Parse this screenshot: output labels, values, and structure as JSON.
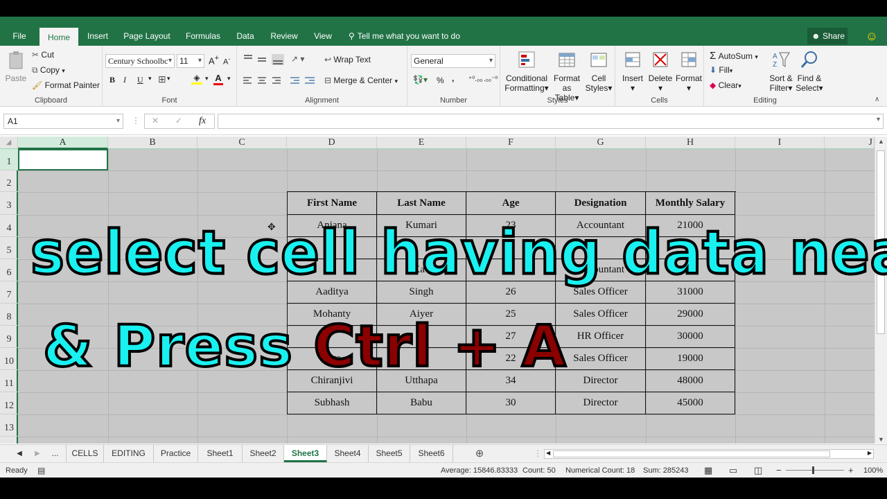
{
  "ribbon_tabs": [
    "File",
    "Home",
    "Insert",
    "Page Layout",
    "Formulas",
    "Data",
    "Review",
    "View",
    "Tell me what you want to do"
  ],
  "share_label": "Share",
  "clipboard": {
    "paste": "Paste",
    "cut": "Cut",
    "copy": "Copy",
    "format_painter": "Format Painter",
    "label": "Clipboard"
  },
  "font": {
    "name": "Century Schoolbc",
    "size": "11",
    "bold": "B",
    "italic": "I",
    "underline": "U",
    "label": "Font"
  },
  "alignment": {
    "wrap": "Wrap Text",
    "merge": "Merge & Center",
    "label": "Alignment"
  },
  "number": {
    "format": "General",
    "percent": "%",
    "comma": ",",
    "label": "Number"
  },
  "styles": {
    "conditional": "Conditional",
    "conditional2": "Formatting",
    "format_table": "Format as",
    "format_table2": "Table",
    "cell_styles": "Cell",
    "cell_styles2": "Styles",
    "label": "Styles"
  },
  "cells_group": {
    "insert": "Insert",
    "delete": "Delete",
    "format": "Format",
    "label": "Cells"
  },
  "editing": {
    "autosum": "AutoSum",
    "fill": "Fill",
    "clear": "Clear",
    "sort": "Sort &",
    "sort2": "Filter",
    "find": "Find &",
    "find2": "Select",
    "label": "Editing"
  },
  "formula_bar": {
    "name_box": "A1",
    "fx": "fx",
    "cancel": "✕",
    "enter": "✓",
    "content": ""
  },
  "columns": [
    "A",
    "B",
    "C",
    "D",
    "E",
    "F",
    "G",
    "H",
    "I",
    "J"
  ],
  "rows": [
    "1",
    "2",
    "3",
    "4",
    "5",
    "6",
    "7",
    "8",
    "9",
    "10",
    "11",
    "12",
    "13"
  ],
  "table": {
    "headers": [
      "First Name",
      "Last Name",
      "Age",
      "Designation",
      "Monthly Salary"
    ],
    "rows": [
      [
        "Anjana",
        "Kumari",
        "23",
        "Accountant",
        "21000"
      ],
      [
        "",
        "",
        "",
        "",
        "",
        ""
      ],
      [
        "",
        "Kav",
        "",
        "Accountant",
        ""
      ],
      [
        "Aaditya",
        "Singh",
        "26",
        "Sales Officer",
        "31000"
      ],
      [
        "Mohanty",
        "Aiyer",
        "25",
        "Sales Officer",
        "29000"
      ],
      [
        "",
        "Pa",
        "27",
        "HR Officer",
        "30000"
      ],
      [
        "Swa",
        "Lo",
        "22",
        "Sales Officer",
        "19000"
      ],
      [
        "Chiranjivi",
        "Utthapa",
        "34",
        "Director",
        "48000"
      ],
      [
        "Subhash",
        "Babu",
        "30",
        "Director",
        "45000"
      ]
    ]
  },
  "overlay": {
    "line1": "select cell having data nearby,",
    "line2a": "& Press ",
    "line2b": "Ctrl + A"
  },
  "sheet_tabs": [
    "...",
    "CELLS",
    "EDITING",
    "Practice",
    "Sheet1",
    "Sheet2",
    "Sheet3",
    "Sheet4",
    "Sheet5",
    "Sheet6"
  ],
  "active_sheet": "Sheet3",
  "status": {
    "ready": "Ready",
    "average": "Average: 15846.83333",
    "count": "Count: 50",
    "numerical_count": "Numerical Count: 18",
    "sum": "Sum: 285243",
    "zoom": "100%"
  },
  "colors": {
    "excel_green": "#217346",
    "overlay_cyan": "#19f0f0",
    "overlay_red": "#8b0000"
  }
}
